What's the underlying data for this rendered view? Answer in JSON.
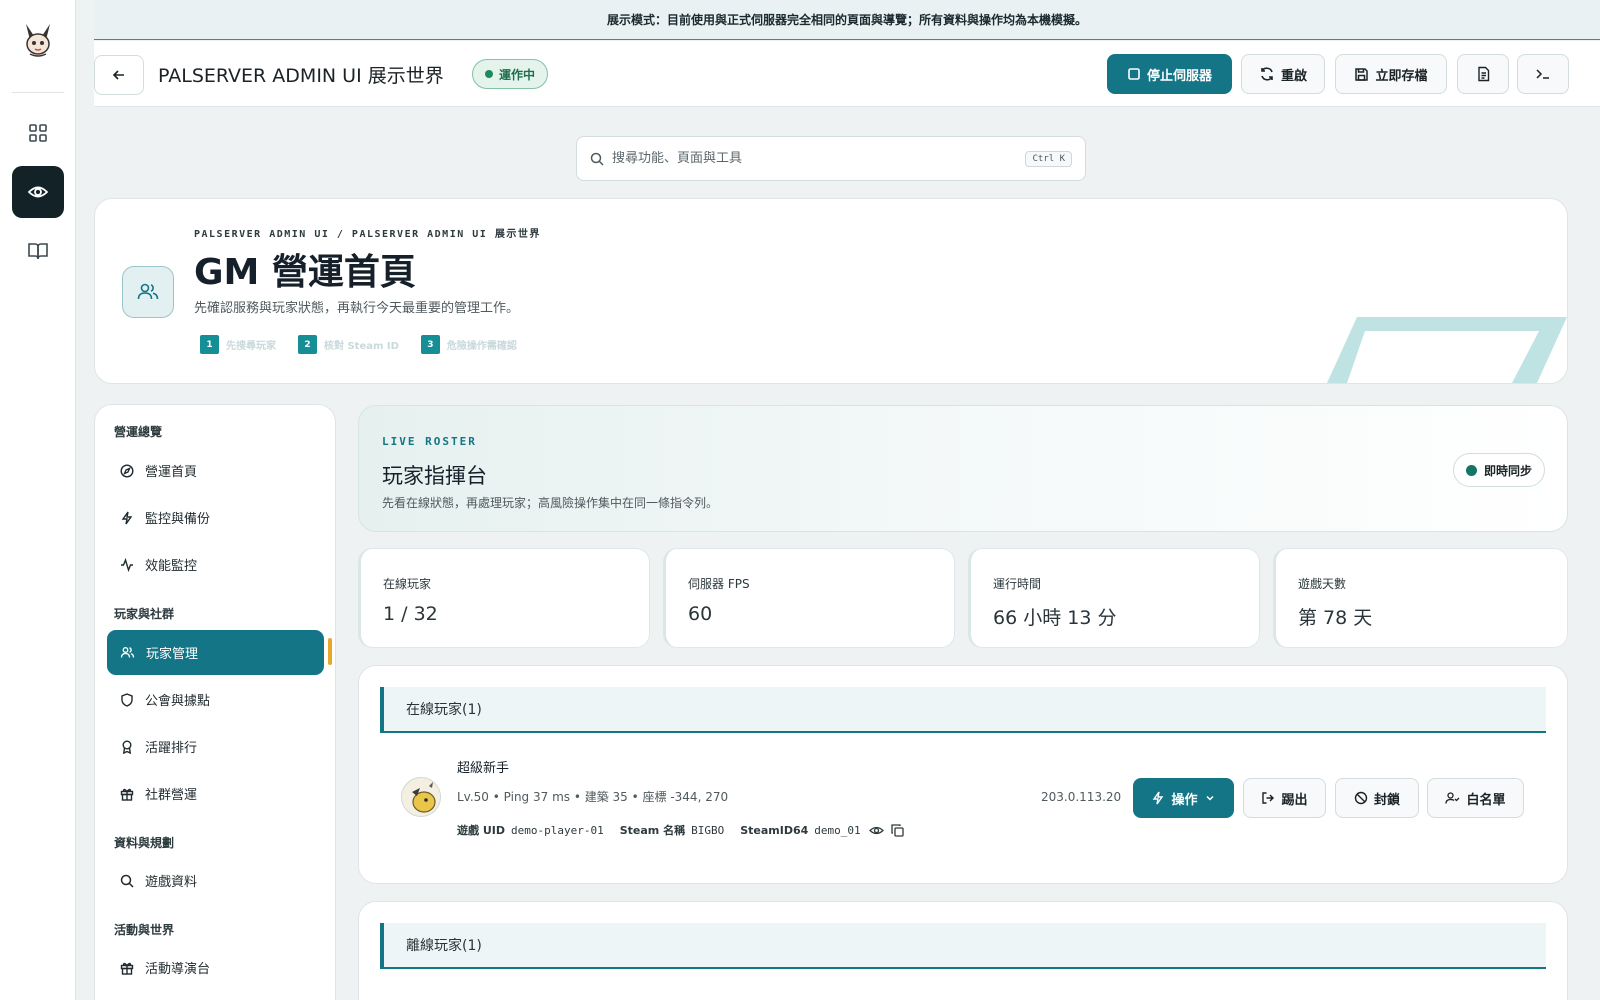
{
  "banner": {
    "text": "展示模式：目前使用與正式伺服器完全相同的頁面與導覽；所有資料與操作均為本機模擬。"
  },
  "rail": {
    "items": [
      "grid-icon",
      "eye-icon",
      "book-icon"
    ]
  },
  "header": {
    "world_title": "PALSERVER ADMIN UI 展示世界",
    "status": "運作中",
    "buttons": {
      "stop": "停止伺服器",
      "restart": "重啟",
      "save": "立即存檔"
    }
  },
  "search": {
    "placeholder": "搜尋功能、頁面與工具",
    "shortcut": "Ctrl K"
  },
  "hero": {
    "breadcrumb": "PALSERVER ADMIN UI / PALSERVER ADMIN UI 展示世界",
    "title": "GM 營運首頁",
    "subtitle": "先確認服務與玩家狀態，再執行今天最重要的管理工作。",
    "steps": [
      {
        "num": "1",
        "label": "先搜尋玩家"
      },
      {
        "num": "2",
        "label": "核對 Steam ID"
      },
      {
        "num": "3",
        "label": "危險操作需確認"
      }
    ]
  },
  "sidebar": {
    "groups": [
      "營運總覽",
      "玩家與社群",
      "資料與規劃",
      "活動與世界"
    ],
    "items": [
      {
        "label": "營運首頁",
        "icon": "compass-icon"
      },
      {
        "label": "監控與備份",
        "icon": "bolt-icon"
      },
      {
        "label": "效能監控",
        "icon": "pulse-icon"
      },
      {
        "label": "玩家管理",
        "icon": "users-icon",
        "active": true
      },
      {
        "label": "公會與據點",
        "icon": "shield-icon"
      },
      {
        "label": "活躍排行",
        "icon": "award-icon"
      },
      {
        "label": "社群營運",
        "icon": "gift-icon"
      },
      {
        "label": "遊戲資料",
        "icon": "search-icon"
      },
      {
        "label": "活動導演台",
        "icon": "gift-icon"
      }
    ]
  },
  "roster": {
    "kicker": "LIVE ROSTER",
    "title": "玩家指揮台",
    "description": "先看在線狀態，再處理玩家；高風險操作集中在同一條指令列。",
    "sync": "即時同步"
  },
  "stats": [
    {
      "label": "在線玩家",
      "value": "1 / 32"
    },
    {
      "label": "伺服器 FPS",
      "value": "60"
    },
    {
      "label": "運行時間",
      "value": "66 小時 13 分"
    },
    {
      "label": "遊戲天數",
      "value": "第 78 天"
    }
  ],
  "online": {
    "header": "在線玩家(1)",
    "player": {
      "name": "超級新手",
      "meta": "Lv.50 • Ping 37 ms • 建築 35 • 座標 -344, 270",
      "uid_label": "遊戲 UID",
      "uid": "demo-player-01",
      "steam_name_label": "Steam 名稱",
      "steam_name": "BIGBO",
      "steamid_label": "SteamID64",
      "steamid": "demo_01",
      "ip": "203.0.113.20"
    },
    "actions": {
      "operate": "操作",
      "kick": "踢出",
      "ban": "封鎖",
      "whitelist": "白名單"
    }
  },
  "offline": {
    "header": "離線玩家(1)"
  },
  "colors": {
    "accent": "#137586",
    "status_green": "#1f8a5d",
    "active_marker": "#e8a92a"
  }
}
